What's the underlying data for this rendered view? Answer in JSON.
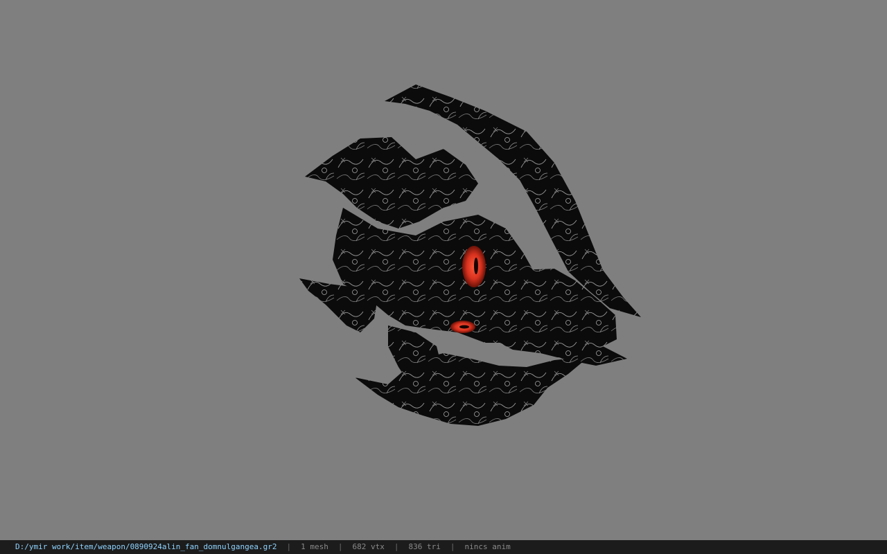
{
  "viewport": {
    "background_color": "#7f7f7f",
    "model_icon": "fan-weapon-model",
    "accent_color": "#d8321f"
  },
  "status_bar": {
    "file_path": "D:/ymir work/item/weapon/0890924alin_fan_domnulgangea.gr2",
    "separator": "|",
    "mesh_count": "1 mesh",
    "vertex_count": "682 vtx",
    "triangle_count": "836 tri",
    "animation": "nincs anim",
    "path_color": "#8fd3ff",
    "background_color": "#1c1c1c"
  }
}
